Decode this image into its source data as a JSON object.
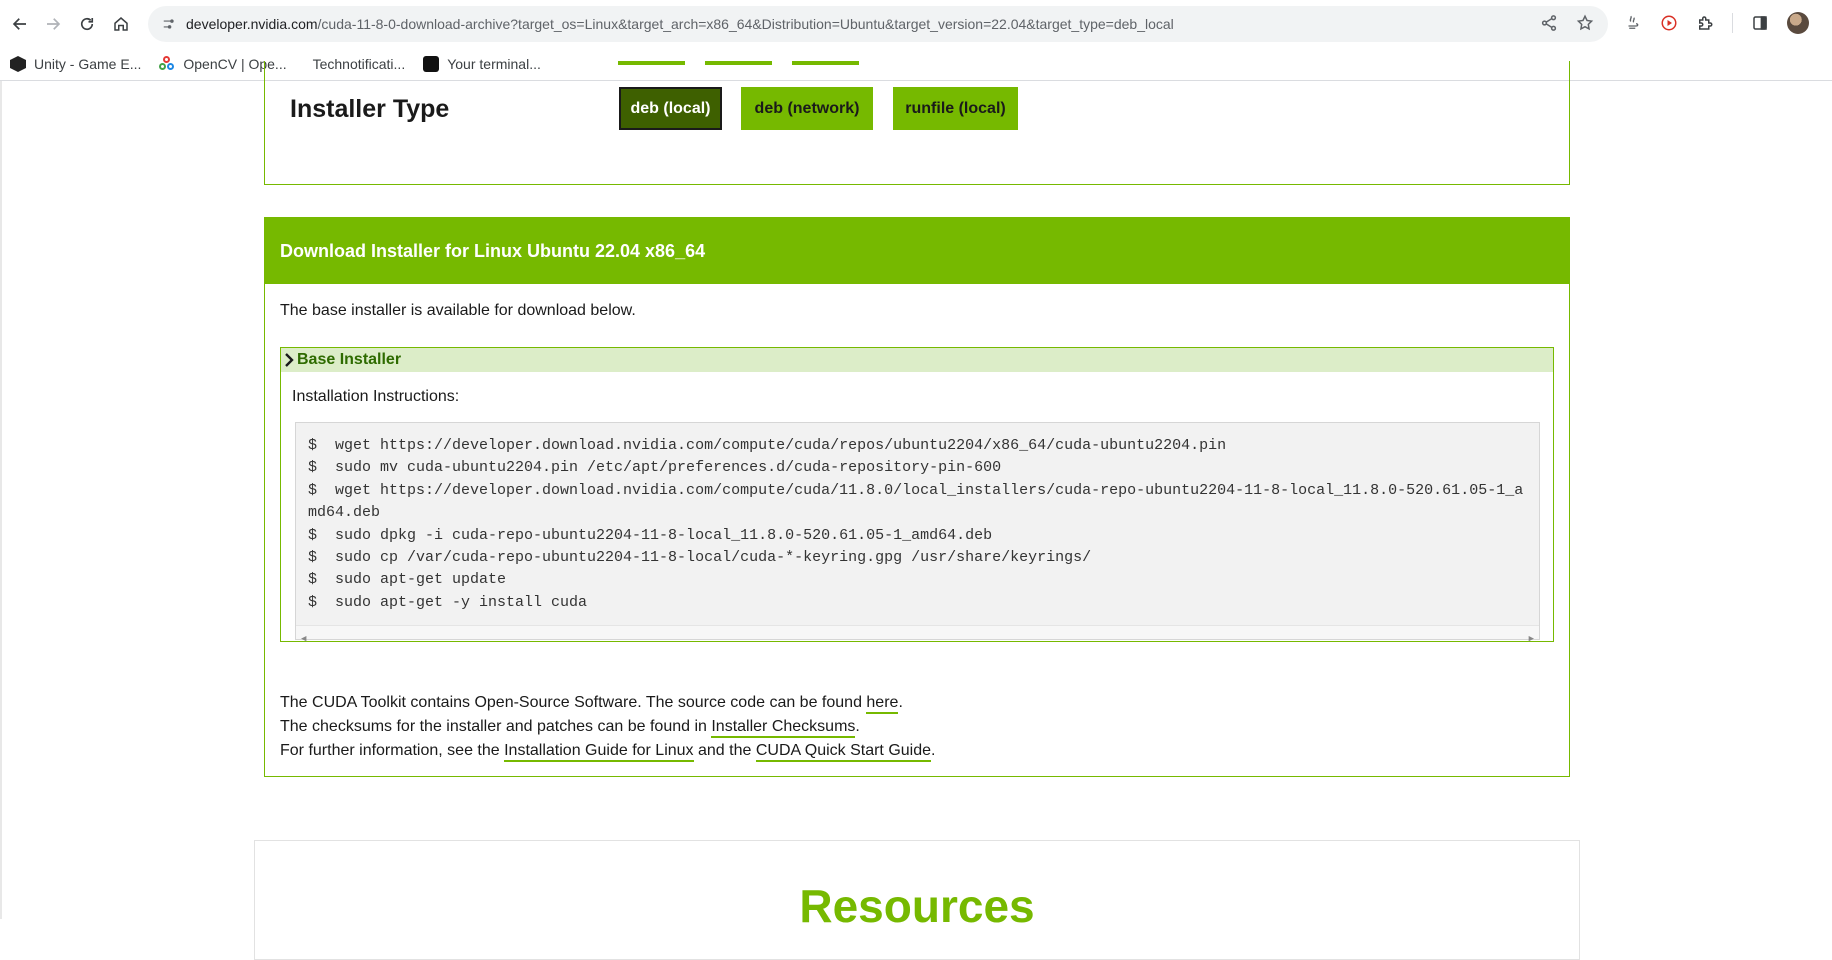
{
  "browser": {
    "url_host": "developer.nvidia.com",
    "url_rest": "/cuda-11-8-0-download-archive?target_os=Linux&target_arch=x86_64&Distribution=Ubuntu&target_version=22.04&target_type=deb_local",
    "bookmarks": [
      {
        "label": "Unity - Game E...",
        "icon": "unity-icon"
      },
      {
        "label": "OpenCV | Ope...",
        "icon": "opencv-icon"
      },
      {
        "label": "Technotificati...",
        "icon": ""
      },
      {
        "label": "Your terminal...",
        "icon": "terminal-icon"
      }
    ]
  },
  "installer_type": {
    "title": "Installer Type",
    "options": [
      {
        "label": "deb (local)",
        "selected": true
      },
      {
        "label": "deb (network)",
        "selected": false
      },
      {
        "label": "runfile (local)",
        "selected": false
      }
    ]
  },
  "download": {
    "header": "Download Installer for Linux Ubuntu 22.04 x86_64",
    "availability": "The base installer is available for download below.",
    "base_installer": {
      "title": "Base Installer",
      "instructions_label": "Installation Instructions:",
      "commands": [
        "$  wget https://developer.download.nvidia.com/compute/cuda/repos/ubuntu2204/x86_64/cuda-ubuntu2204.pin",
        "$  sudo mv cuda-ubuntu2204.pin /etc/apt/preferences.d/cuda-repository-pin-600",
        "$  wget https://developer.download.nvidia.com/compute/cuda/11.8.0/local_installers/cuda-repo-ubuntu2204-11-8-local_11.8.0-520.61.05-1_amd64.deb",
        "$  sudo dpkg -i cuda-repo-ubuntu2204-11-8-local_11.8.0-520.61.05-1_amd64.deb",
        "$  sudo cp /var/cuda-repo-ubuntu2204-11-8-local/cuda-*-keyring.gpg /usr/share/keyrings/",
        "$  sudo apt-get update",
        "$  sudo apt-get -y install cuda"
      ]
    },
    "info": {
      "line1_prefix": "The CUDA Toolkit contains Open-Source Software. The source code can be found ",
      "line1_link": "here",
      "line1_suffix": ".",
      "line2_prefix": "The checksums for the installer and patches can be found in ",
      "line2_link": "Installer Checksums",
      "line2_suffix": ".",
      "line3_prefix": "For further information, see the ",
      "line3_link1": "Installation Guide for Linux",
      "line3_middle": " and the ",
      "line3_link2": "CUDA Quick Start Guide",
      "line3_suffix": "."
    }
  },
  "resources": {
    "title": "Resources"
  },
  "colors": {
    "nvidia_green": "#76b900",
    "selected_green": "#3e6000"
  }
}
